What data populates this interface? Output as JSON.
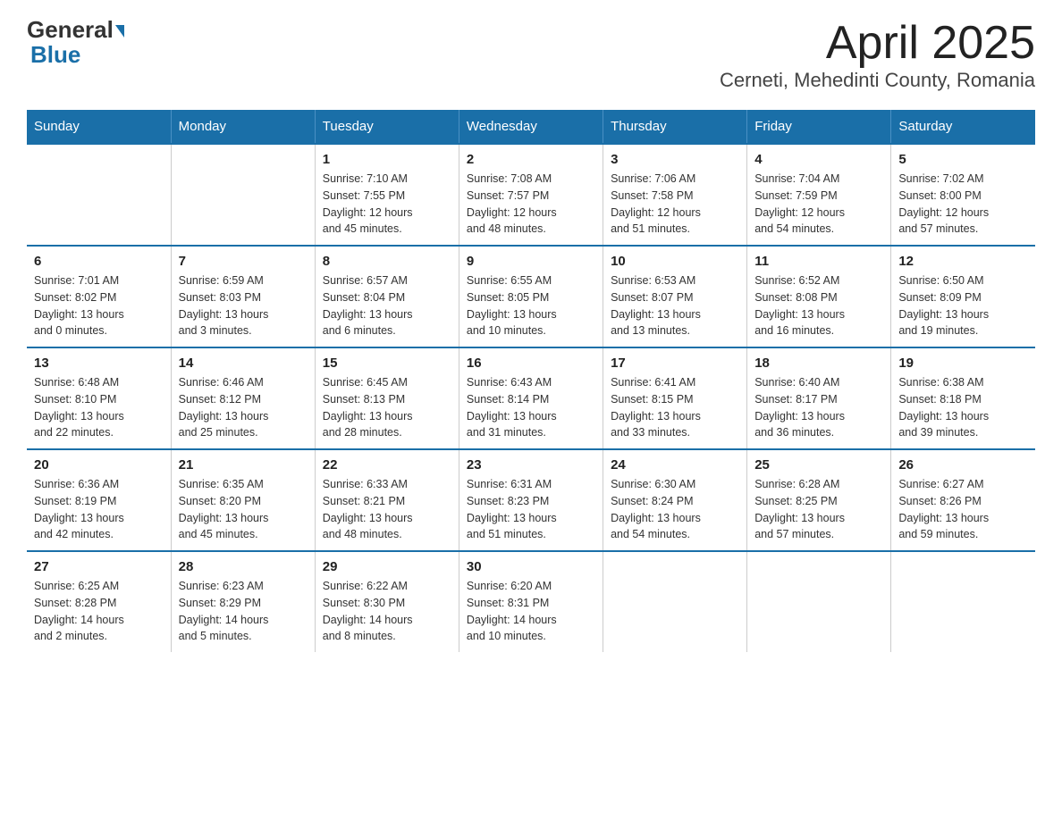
{
  "header": {
    "logo_general": "General",
    "logo_blue": "Blue",
    "title": "April 2025",
    "subtitle": "Cerneti, Mehedinti County, Romania"
  },
  "calendar": {
    "days_of_week": [
      "Sunday",
      "Monday",
      "Tuesday",
      "Wednesday",
      "Thursday",
      "Friday",
      "Saturday"
    ],
    "weeks": [
      [
        {
          "day": "",
          "info": ""
        },
        {
          "day": "",
          "info": ""
        },
        {
          "day": "1",
          "info": "Sunrise: 7:10 AM\nSunset: 7:55 PM\nDaylight: 12 hours\nand 45 minutes."
        },
        {
          "day": "2",
          "info": "Sunrise: 7:08 AM\nSunset: 7:57 PM\nDaylight: 12 hours\nand 48 minutes."
        },
        {
          "day": "3",
          "info": "Sunrise: 7:06 AM\nSunset: 7:58 PM\nDaylight: 12 hours\nand 51 minutes."
        },
        {
          "day": "4",
          "info": "Sunrise: 7:04 AM\nSunset: 7:59 PM\nDaylight: 12 hours\nand 54 minutes."
        },
        {
          "day": "5",
          "info": "Sunrise: 7:02 AM\nSunset: 8:00 PM\nDaylight: 12 hours\nand 57 minutes."
        }
      ],
      [
        {
          "day": "6",
          "info": "Sunrise: 7:01 AM\nSunset: 8:02 PM\nDaylight: 13 hours\nand 0 minutes."
        },
        {
          "day": "7",
          "info": "Sunrise: 6:59 AM\nSunset: 8:03 PM\nDaylight: 13 hours\nand 3 minutes."
        },
        {
          "day": "8",
          "info": "Sunrise: 6:57 AM\nSunset: 8:04 PM\nDaylight: 13 hours\nand 6 minutes."
        },
        {
          "day": "9",
          "info": "Sunrise: 6:55 AM\nSunset: 8:05 PM\nDaylight: 13 hours\nand 10 minutes."
        },
        {
          "day": "10",
          "info": "Sunrise: 6:53 AM\nSunset: 8:07 PM\nDaylight: 13 hours\nand 13 minutes."
        },
        {
          "day": "11",
          "info": "Sunrise: 6:52 AM\nSunset: 8:08 PM\nDaylight: 13 hours\nand 16 minutes."
        },
        {
          "day": "12",
          "info": "Sunrise: 6:50 AM\nSunset: 8:09 PM\nDaylight: 13 hours\nand 19 minutes."
        }
      ],
      [
        {
          "day": "13",
          "info": "Sunrise: 6:48 AM\nSunset: 8:10 PM\nDaylight: 13 hours\nand 22 minutes."
        },
        {
          "day": "14",
          "info": "Sunrise: 6:46 AM\nSunset: 8:12 PM\nDaylight: 13 hours\nand 25 minutes."
        },
        {
          "day": "15",
          "info": "Sunrise: 6:45 AM\nSunset: 8:13 PM\nDaylight: 13 hours\nand 28 minutes."
        },
        {
          "day": "16",
          "info": "Sunrise: 6:43 AM\nSunset: 8:14 PM\nDaylight: 13 hours\nand 31 minutes."
        },
        {
          "day": "17",
          "info": "Sunrise: 6:41 AM\nSunset: 8:15 PM\nDaylight: 13 hours\nand 33 minutes."
        },
        {
          "day": "18",
          "info": "Sunrise: 6:40 AM\nSunset: 8:17 PM\nDaylight: 13 hours\nand 36 minutes."
        },
        {
          "day": "19",
          "info": "Sunrise: 6:38 AM\nSunset: 8:18 PM\nDaylight: 13 hours\nand 39 minutes."
        }
      ],
      [
        {
          "day": "20",
          "info": "Sunrise: 6:36 AM\nSunset: 8:19 PM\nDaylight: 13 hours\nand 42 minutes."
        },
        {
          "day": "21",
          "info": "Sunrise: 6:35 AM\nSunset: 8:20 PM\nDaylight: 13 hours\nand 45 minutes."
        },
        {
          "day": "22",
          "info": "Sunrise: 6:33 AM\nSunset: 8:21 PM\nDaylight: 13 hours\nand 48 minutes."
        },
        {
          "day": "23",
          "info": "Sunrise: 6:31 AM\nSunset: 8:23 PM\nDaylight: 13 hours\nand 51 minutes."
        },
        {
          "day": "24",
          "info": "Sunrise: 6:30 AM\nSunset: 8:24 PM\nDaylight: 13 hours\nand 54 minutes."
        },
        {
          "day": "25",
          "info": "Sunrise: 6:28 AM\nSunset: 8:25 PM\nDaylight: 13 hours\nand 57 minutes."
        },
        {
          "day": "26",
          "info": "Sunrise: 6:27 AM\nSunset: 8:26 PM\nDaylight: 13 hours\nand 59 minutes."
        }
      ],
      [
        {
          "day": "27",
          "info": "Sunrise: 6:25 AM\nSunset: 8:28 PM\nDaylight: 14 hours\nand 2 minutes."
        },
        {
          "day": "28",
          "info": "Sunrise: 6:23 AM\nSunset: 8:29 PM\nDaylight: 14 hours\nand 5 minutes."
        },
        {
          "day": "29",
          "info": "Sunrise: 6:22 AM\nSunset: 8:30 PM\nDaylight: 14 hours\nand 8 minutes."
        },
        {
          "day": "30",
          "info": "Sunrise: 6:20 AM\nSunset: 8:31 PM\nDaylight: 14 hours\nand 10 minutes."
        },
        {
          "day": "",
          "info": ""
        },
        {
          "day": "",
          "info": ""
        },
        {
          "day": "",
          "info": ""
        }
      ]
    ]
  }
}
